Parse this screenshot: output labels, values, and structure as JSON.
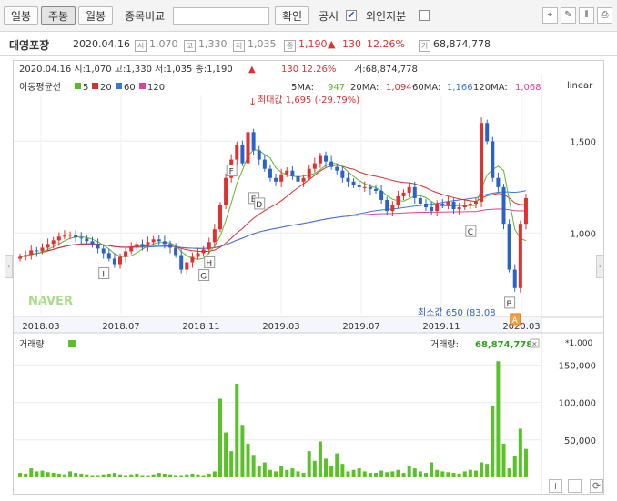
{
  "toolbar": {
    "daily_label": "일봉",
    "weekly_label": "주봉",
    "monthly_label": "월봉",
    "compare_label": "종목비교",
    "confirm_label": "확인",
    "disclosure_label": "공시",
    "disclosure_checked": "✔",
    "foreign_label": "외인지분"
  },
  "stock": {
    "name": "대영포장",
    "date": "2020.04.16",
    "open_badge": "시",
    "open": "1,070",
    "high_badge": "고",
    "high": "1,330",
    "low_badge": "저",
    "low": "1,035",
    "close_badge": "종",
    "close": "1,190",
    "change_arrow": "▲",
    "change": "130",
    "change_pct": "12.26%",
    "volume_badge": "거",
    "volume": "68,874,778"
  },
  "price_header": {
    "text": "2020.04.16  시:1,070  고:1,330  저:1,035  종:1,190",
    "arrow": "▲",
    "change": "130  12.26%",
    "volume": "거:68,874,778"
  },
  "ma_legend": {
    "label": "이동평균선",
    "p5": "5",
    "p20": "20",
    "p60": "60",
    "p120": "120",
    "ma5_label": "5MA:",
    "ma5": "947",
    "ma20_label": "20MA:",
    "ma20": "1,094",
    "ma60_label": "60MA:",
    "ma60": "1,166",
    "ma120_label": "120MA:",
    "ma120": "1,068"
  },
  "scale_label": "linear",
  "watermark": "NAVER",
  "annotations": {
    "max_arrow": "↓",
    "max": "최대값 1,695 (-29.79%)",
    "min": "최소값 650 (83,08",
    "letters": [
      "F",
      "E",
      "D",
      "H",
      "G",
      "I",
      "C",
      "B",
      "A"
    ]
  },
  "volume_panel": {
    "title": "거래량",
    "label": "거래량:",
    "value": "68,874,778",
    "close_icon": "✕",
    "unit": "*1,000"
  },
  "colors": {
    "up": "#e03030",
    "down": "#2b62c8",
    "ma5": "#5ab82a",
    "ma20": "#d43030",
    "ma60": "#3a78d8",
    "ma120": "#e040a0",
    "volume": "#59c228"
  },
  "chart_data": {
    "type": "candlestick",
    "period": "weekly",
    "y_ticks": [
      1000,
      1500
    ],
    "y_tick_labels": [
      "1,000",
      "1,500"
    ],
    "ylim": [
      560,
      1750
    ],
    "x_tick_labels": [
      "2018.03",
      "2018.07",
      "2018.11",
      "2019.03",
      "2019.07",
      "2019.11",
      "2020.03"
    ],
    "close": [
      870,
      880,
      905,
      900,
      920,
      940,
      960,
      980,
      985,
      990,
      975,
      970,
      955,
      940,
      915,
      890,
      860,
      830,
      870,
      900,
      920,
      940,
      930,
      950,
      965,
      955,
      940,
      920,
      880,
      800,
      840,
      870,
      890,
      910,
      950,
      1020,
      1150,
      1300,
      1400,
      1480,
      1380,
      1550,
      1450,
      1400,
      1350,
      1300,
      1280,
      1320,
      1340,
      1310,
      1280,
      1300,
      1350,
      1380,
      1420,
      1390,
      1360,
      1340,
      1300,
      1280,
      1260,
      1250,
      1250,
      1240,
      1230,
      1180,
      1120,
      1150,
      1200,
      1220,
      1250,
      1190,
      1160,
      1140,
      1120,
      1160,
      1150,
      1170,
      1130,
      1140,
      1150,
      1160,
      1170,
      1600,
      1500,
      1300,
      1250,
      1050,
      800,
      700,
      1050,
      1190
    ],
    "ma5_last": 947,
    "ma20_last": 1094,
    "ma60_last": 1166,
    "ma120_last": 1068,
    "max_value": 1695,
    "min_value": 650,
    "volume_y_ticks": [
      50000,
      100000,
      150000
    ],
    "volume_y_tick_labels": [
      "50,000",
      "100,000",
      "150,000"
    ],
    "volume_ylim": [
      0,
      165000
    ],
    "volume": [
      6000,
      5000,
      12000,
      8000,
      9000,
      7000,
      6000,
      5000,
      4000,
      8000,
      6000,
      5000,
      4000,
      3000,
      3000,
      4000,
      5000,
      6000,
      4000,
      3000,
      4000,
      5000,
      3000,
      3000,
      4000,
      6000,
      5000,
      4000,
      3000,
      3000,
      4000,
      5000,
      4000,
      3000,
      5000,
      8000,
      105000,
      60000,
      35000,
      125000,
      70000,
      45000,
      30000,
      15000,
      20000,
      10000,
      8000,
      15000,
      10000,
      12000,
      8000,
      6000,
      35000,
      22000,
      48000,
      25000,
      15000,
      32000,
      18000,
      8000,
      10000,
      12000,
      8000,
      6000,
      6000,
      9000,
      7000,
      8000,
      10000,
      6000,
      15000,
      12000,
      8000,
      6000,
      20000,
      10000,
      8000,
      7000,
      6000,
      5000,
      8000,
      10000,
      9000,
      20000,
      18000,
      95000,
      155000,
      45000,
      12000,
      28000,
      65000,
      38000
    ]
  }
}
